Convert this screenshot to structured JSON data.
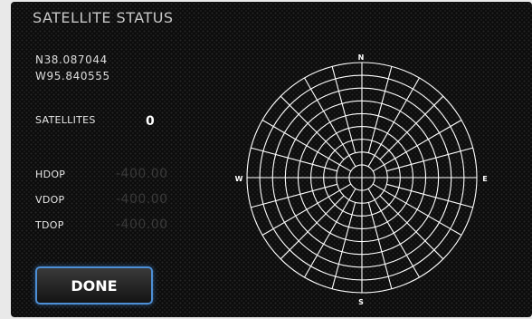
{
  "screen": {
    "title": "SATELLITE STATUS"
  },
  "position": {
    "latitude": "N38.087044",
    "longitude": "W95.840555"
  },
  "satellites": {
    "label": "SATELLITES",
    "count": "0"
  },
  "dop": [
    {
      "label": "HDOP",
      "value": "-400.00"
    },
    {
      "label": "VDOP",
      "value": "-400.00"
    },
    {
      "label": "TDOP",
      "value": "-400.00"
    }
  ],
  "sky_plot": {
    "north": "N",
    "south": "S",
    "east": "E",
    "west": "W"
  },
  "actions": {
    "done_label": "DONE"
  },
  "colors": {
    "background": "#0c0c0c",
    "button_border": "#4d8fd6",
    "grid_lines": "#ffffff"
  }
}
